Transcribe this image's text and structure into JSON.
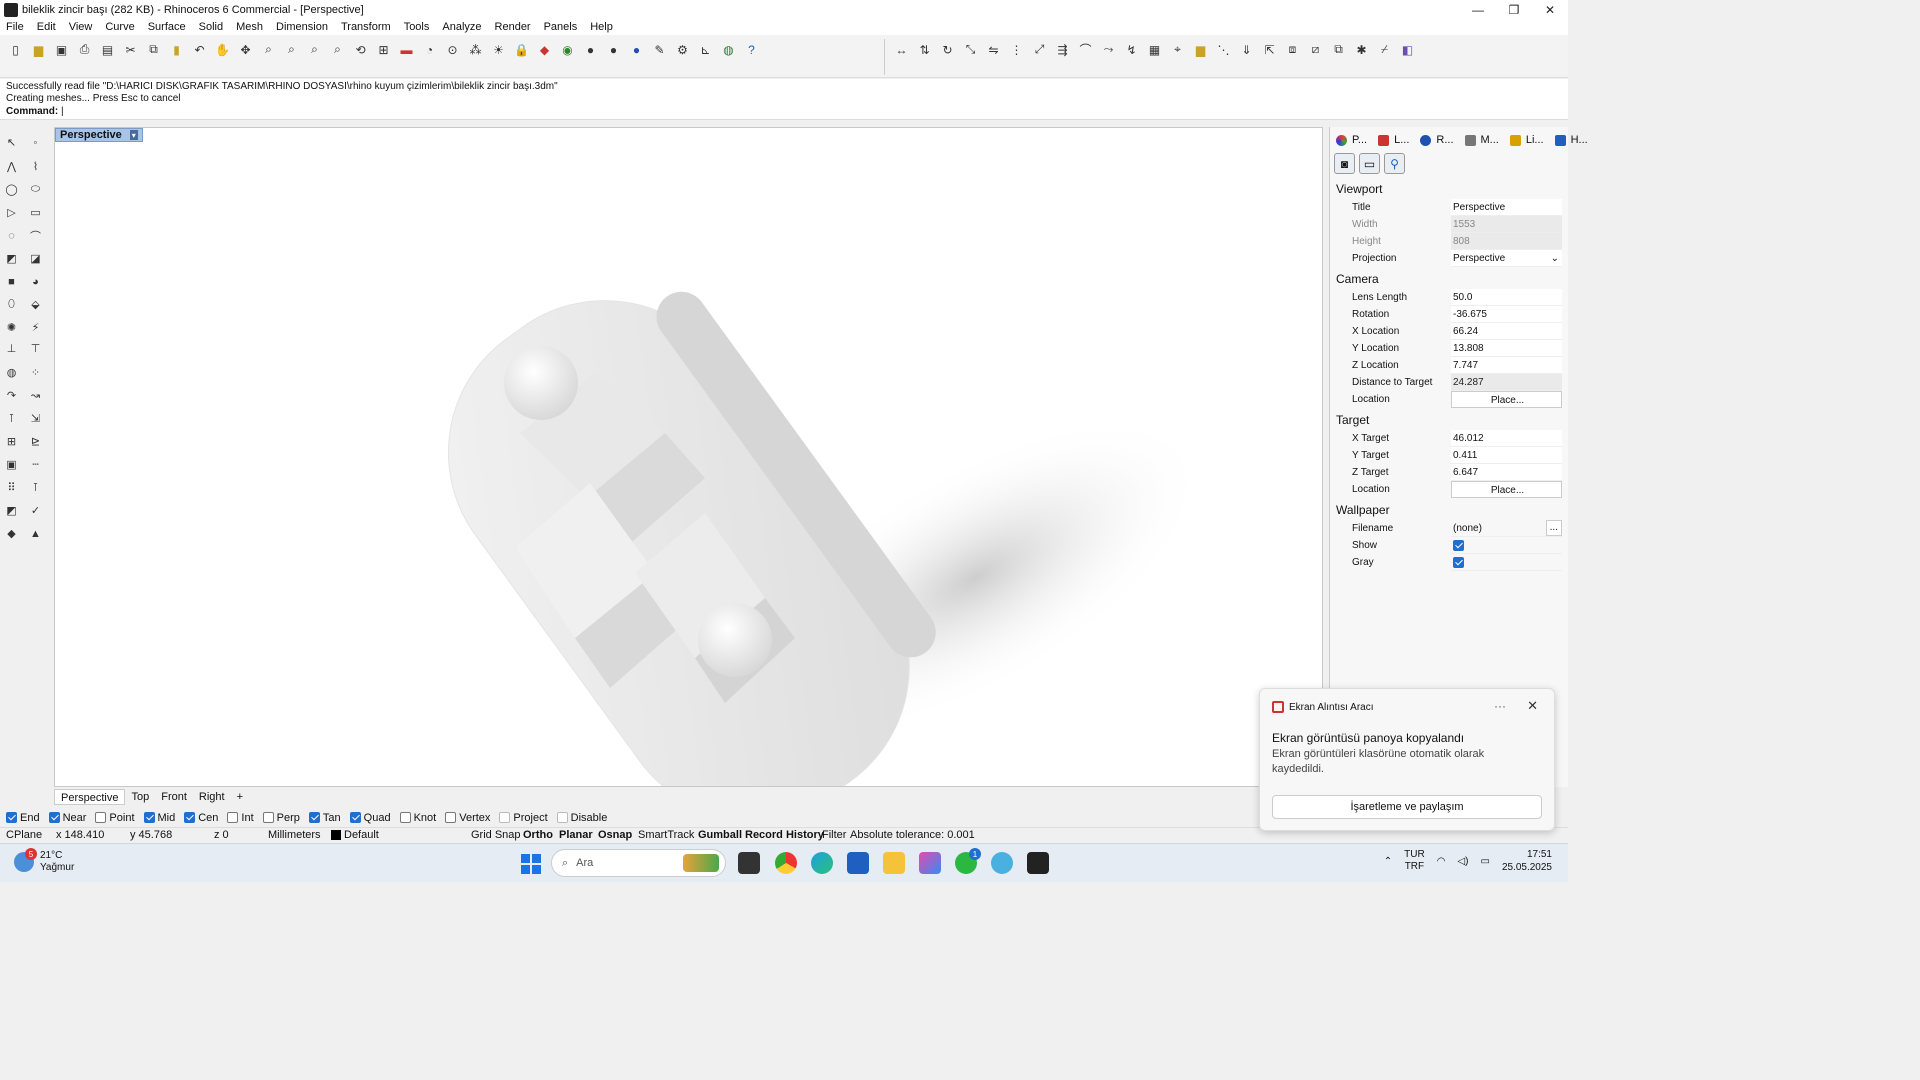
{
  "window": {
    "title": "bileklik zincir başı (282 KB) - Rhinoceros 6 Commercial - [Perspective]",
    "controls": [
      "—",
      "❐",
      "✕"
    ]
  },
  "menu": [
    "File",
    "Edit",
    "View",
    "Curve",
    "Surface",
    "Solid",
    "Mesh",
    "Dimension",
    "Transform",
    "Tools",
    "Analyze",
    "Render",
    "Panels",
    "Help"
  ],
  "command": {
    "history1": "Successfully read file \"D:\\HARICI DISK\\GRAFIK TASARIM\\RHINO DOSYASI\\rhino kuyum çizimlerim\\bileklik zincir başı.3dm\"",
    "history2": "Creating meshes... Press Esc to cancel",
    "prompt": "Command:"
  },
  "viewport": {
    "active_tab": "Perspective"
  },
  "view_tabs": [
    "Perspective",
    "Top",
    "Front",
    "Right",
    "+"
  ],
  "osnap": [
    {
      "label": "End",
      "checked": true
    },
    {
      "label": "Near",
      "checked": true
    },
    {
      "label": "Point",
      "checked": false
    },
    {
      "label": "Mid",
      "checked": true
    },
    {
      "label": "Cen",
      "checked": true
    },
    {
      "label": "Int",
      "checked": false
    },
    {
      "label": "Perp",
      "checked": false
    },
    {
      "label": "Tan",
      "checked": true
    },
    {
      "label": "Quad",
      "checked": true
    },
    {
      "label": "Knot",
      "checked": false
    },
    {
      "label": "Vertex",
      "checked": false
    },
    {
      "label": "Project",
      "checked": false
    },
    {
      "label": "Disable",
      "checked": false
    }
  ],
  "status": {
    "cplane": "CPlane",
    "x": "x 148.410",
    "y": "y 45.768",
    "z": "z 0",
    "units": "Millimeters",
    "layer": "Default",
    "gridsnap": "Grid Snap",
    "ortho": "Ortho",
    "planar": "Planar",
    "osnap": "Osnap",
    "smarttrack": "SmartTrack",
    "gumball": "Gumball",
    "record": "Record History",
    "filter": "Filter",
    "tolerance": "Absolute tolerance: 0.001"
  },
  "panel": {
    "tabs": [
      "P...",
      "L...",
      "R...",
      "M...",
      "Li...",
      "H..."
    ],
    "viewport_section": "Viewport",
    "title_k": "Title",
    "title_v": "Perspective",
    "width_k": "Width",
    "width_v": "1553",
    "height_k": "Height",
    "height_v": "808",
    "projection_k": "Projection",
    "projection_v": "Perspective",
    "camera_section": "Camera",
    "lens_k": "Lens Length",
    "lens_v": "50.0",
    "rotation_k": "Rotation",
    "rotation_v": "-36.675",
    "xloc_k": "X Location",
    "xloc_v": "66.24",
    "yloc_k": "Y Location",
    "yloc_v": "13.808",
    "zloc_k": "Z Location",
    "zloc_v": "7.747",
    "dist_k": "Distance to Target",
    "dist_v": "24.287",
    "loc_k": "Location",
    "loc_v": "Place...",
    "target_section": "Target",
    "xt_k": "X Target",
    "xt_v": "46.012",
    "yt_k": "Y Target",
    "yt_v": "0.411",
    "zt_k": "Z Target",
    "zt_v": "6.647",
    "tloc_k": "Location",
    "tloc_v": "Place...",
    "wallpaper_section": "Wallpaper",
    "file_k": "Filename",
    "file_v": "(none)",
    "file_btn": "...",
    "show_k": "Show",
    "gray_k": "Gray"
  },
  "notification": {
    "app": "Ekran Alıntısı Aracı",
    "more": "···",
    "close": "✕",
    "heading": "Ekran görüntüsü panoya kopyalandı",
    "body": "Ekran görüntüleri klasörüne otomatik olarak kaydedildi.",
    "action": "İşaretleme ve paylaşım"
  },
  "taskbar": {
    "temp": "21°C",
    "weather": "Yağmur",
    "weather_badge": "5",
    "search": "Ara",
    "lang1": "TUR",
    "lang2": "TRF",
    "time": "17:51",
    "date": "25.05.2025",
    "whatsapp_badge": "1"
  },
  "colors": {
    "accent": "#1f6fd0",
    "viewport_tab": "#a9c4e6"
  }
}
